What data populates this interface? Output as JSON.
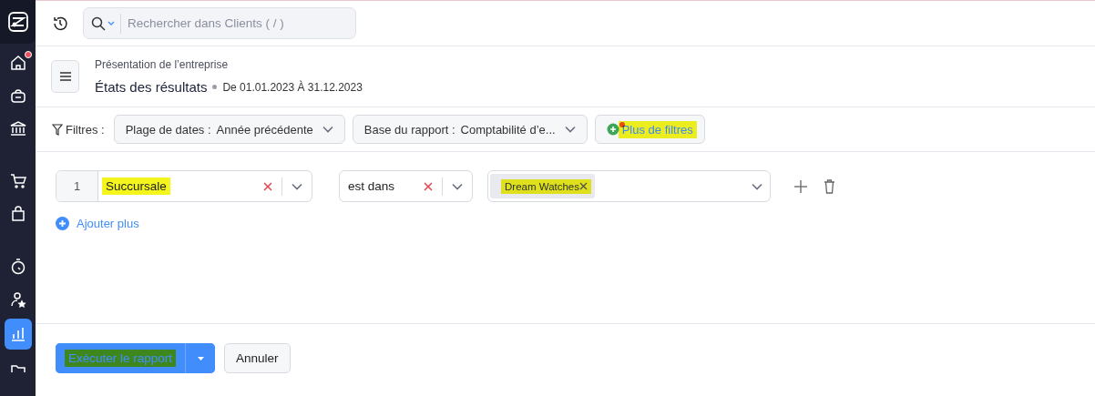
{
  "sidebar": {
    "items": [
      {
        "kind": "logo",
        "selected": false,
        "notification": false
      },
      {
        "kind": "home",
        "selected": false,
        "notification": true
      },
      {
        "kind": "basket",
        "selected": false,
        "notification": false
      },
      {
        "kind": "bank",
        "selected": false,
        "notification": false
      },
      {
        "kind": "cart",
        "selected": false,
        "notification": false
      },
      {
        "kind": "bag",
        "selected": false,
        "notification": false
      },
      {
        "kind": "timer",
        "selected": false,
        "notification": false
      },
      {
        "kind": "user",
        "selected": false,
        "notification": false
      },
      {
        "kind": "chart",
        "selected": true,
        "notification": false
      },
      {
        "kind": "folder",
        "selected": false,
        "notification": false
      }
    ]
  },
  "top_bar": {
    "search": {
      "placeholder": "Rechercher dans Clients ( / )"
    }
  },
  "header": {
    "breadcrumb": "Présentation de l’entreprise",
    "title": "États des résultats",
    "period": "De 01.01.2023 À 31.12.2023"
  },
  "filters": {
    "label": "Filtres :",
    "dropdowns": [
      {
        "label": "Plage de dates :",
        "value": "Année précédente"
      },
      {
        "label": "Base du rapport :",
        "value": "Comptabilité d’e..."
      }
    ],
    "more_button": {
      "label": "Plus de filtres",
      "highlighted": true
    }
  },
  "conditions": [
    {
      "index": "1",
      "field": "Succursale",
      "field_highlighted": true,
      "operator": "est dans",
      "values": [
        {
          "label": "Dream Watches",
          "highlighted": true
        }
      ]
    }
  ],
  "add_more": "Ajouter plus",
  "footer": {
    "run_button": {
      "label": "Exécuter le rapport",
      "highlighted": true
    },
    "cancel_button": "Annuler"
  }
}
